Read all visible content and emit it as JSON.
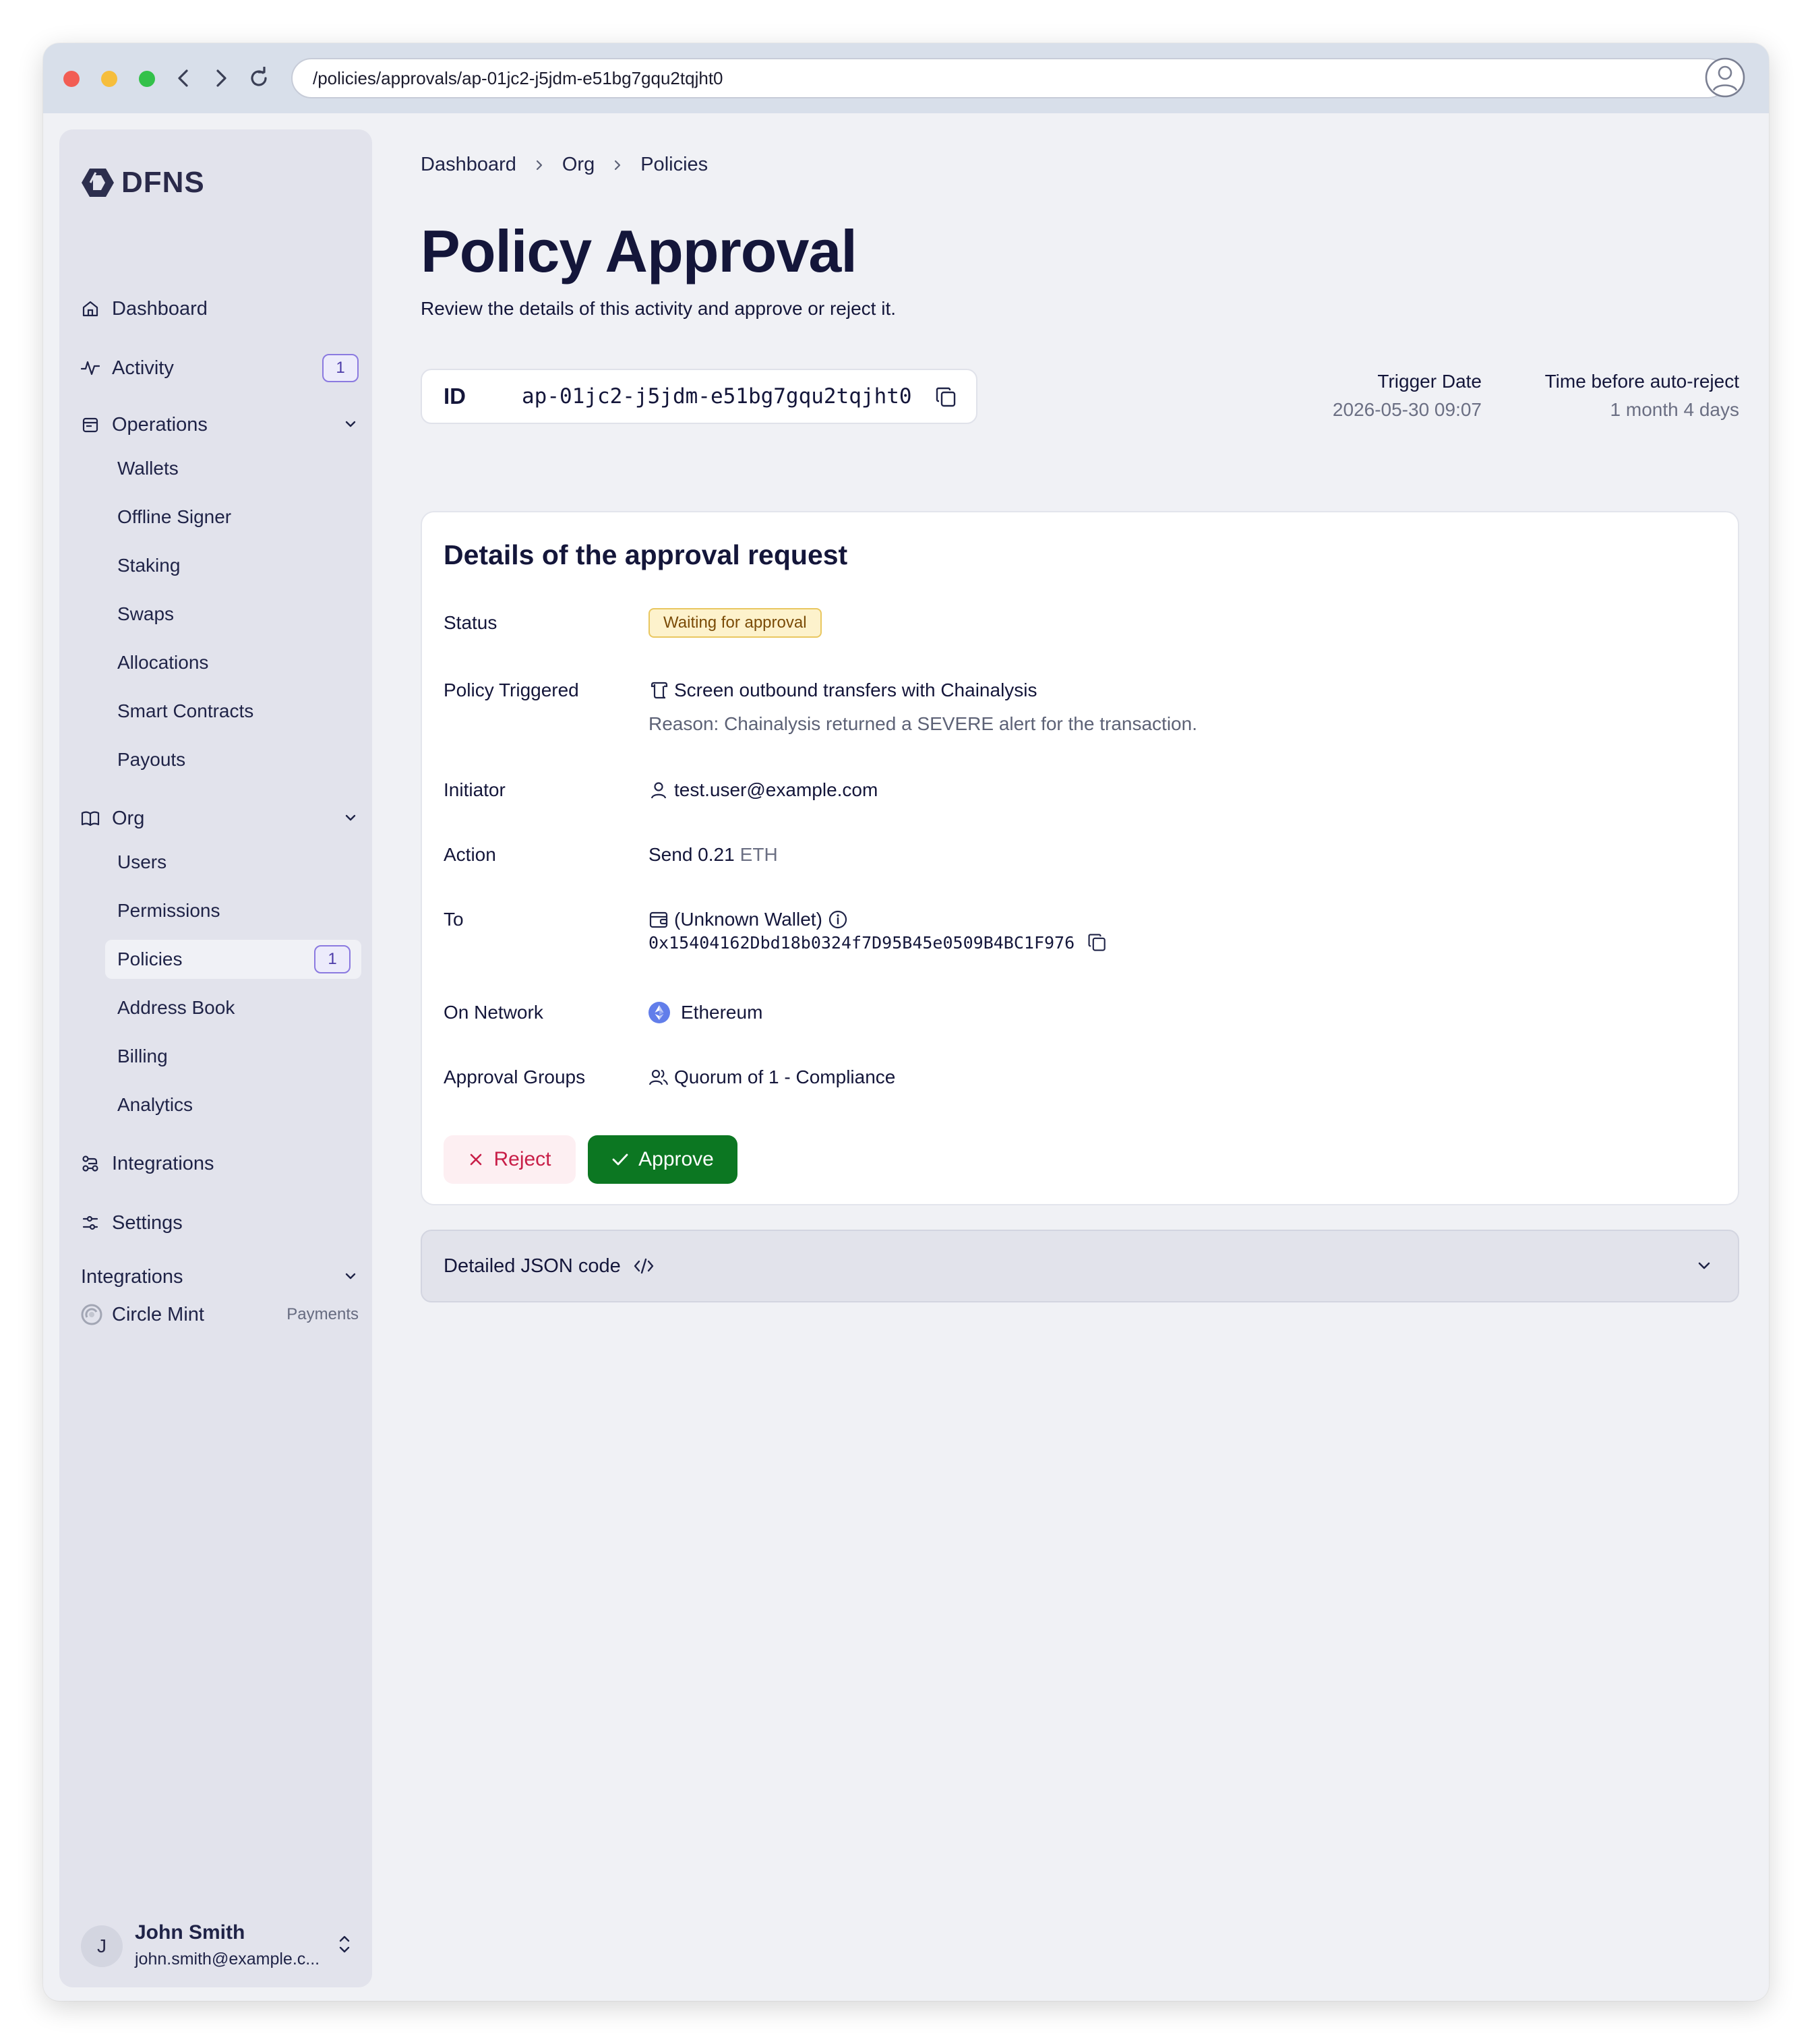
{
  "browser": {
    "url": "/policies/approvals/ap-01jc2-j5jdm-e51bg7gqu2tqjht0"
  },
  "sidebar": {
    "brand": "DFNS",
    "items": {
      "dashboard": "Dashboard",
      "activity": "Activity",
      "activity_badge": "1",
      "operations": "Operations",
      "org": "Org",
      "integrations": "Integrations",
      "settings": "Settings"
    },
    "operations_sub": [
      "Wallets",
      "Offline Signer",
      "Staking",
      "Swaps",
      "Allocations",
      "Smart Contracts",
      "Payouts"
    ],
    "org_sub": [
      "Users",
      "Permissions",
      "Policies",
      "Address Book",
      "Billing",
      "Analytics"
    ],
    "policies_badge": "1",
    "integrations_section": {
      "title": "Integrations",
      "app": "Circle Mint",
      "app_tag": "Payments"
    },
    "user": {
      "initial": "J",
      "name": "John Smith",
      "email": "john.smith@example.c..."
    }
  },
  "breadcrumb": [
    "Dashboard",
    "Org",
    "Policies"
  ],
  "page": {
    "title": "Policy Approval",
    "description": "Review the details of this activity and approve or reject it."
  },
  "id_box": {
    "label": "ID",
    "value": "ap-01jc2-j5jdm-e51bg7gqu2tqjht0"
  },
  "meta": {
    "trigger_label": "Trigger Date",
    "trigger_value": "2026-05-30 09:07",
    "auto_reject_label": "Time before auto-reject",
    "auto_reject_value": "1 month 4 days"
  },
  "details": {
    "title": "Details of the approval request",
    "status_label": "Status",
    "status_value": "Waiting for approval",
    "policy_label": "Policy Triggered",
    "policy_value": "Screen outbound transfers with Chainalysis",
    "policy_reason": "Reason: Chainalysis returned a SEVERE alert for the transaction.",
    "initiator_label": "Initiator",
    "initiator_value": "test.user@example.com",
    "action_label": "Action",
    "action_amount": "Send 0.21",
    "action_asset": "ETH",
    "to_label": "To",
    "to_wallet": "(Unknown Wallet)",
    "to_address": "0x15404162Dbd18b0324f7D95B45e0509B4BC1F976",
    "network_label": "On Network",
    "network_value": "Ethereum",
    "groups_label": "Approval Groups",
    "groups_value": "Quorum of 1 - Compliance",
    "reject_label": "Reject",
    "approve_label": "Approve"
  },
  "json_section": {
    "label": "Detailed JSON code"
  },
  "colors": {
    "approve": "#0c7722",
    "reject": "#c81e48",
    "status_bg": "#fdf2cc",
    "badge_border": "#8b7ae0"
  }
}
